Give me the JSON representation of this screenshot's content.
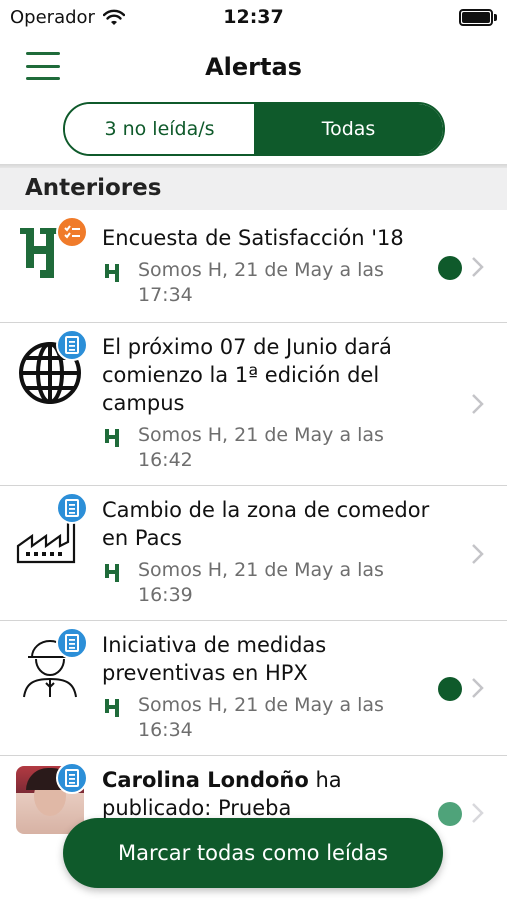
{
  "status_bar": {
    "carrier": "Operador",
    "time": "12:37"
  },
  "header": {
    "title": "Alertas"
  },
  "segmented": {
    "unread_label": "3 no leída/s",
    "all_label": "Todas",
    "selected": "Todas"
  },
  "section": {
    "title": "Anteriores"
  },
  "alerts": [
    {
      "icon": "h-logo-icon",
      "badge": "checklist-icon",
      "badge_color": "#f07b2a",
      "title": "Encuesta de Satisfacción '18",
      "author_bold": "",
      "meta": "Somos H, 21 de May a las 17:34",
      "unread": true
    },
    {
      "icon": "globe-icon",
      "badge": "document-icon",
      "badge_color": "#2c8fd8",
      "title": "El próximo 07 de Junio dará comienzo la 1ª edición del campus",
      "author_bold": "",
      "meta": "Somos H, 21 de May a las 16:42",
      "unread": false
    },
    {
      "icon": "factory-icon",
      "badge": "document-icon",
      "badge_color": "#2c8fd8",
      "title": "Cambio de la zona de comedor en Pacs",
      "author_bold": "",
      "meta": "Somos H, 21 de May a las 16:39",
      "unread": false
    },
    {
      "icon": "worker-icon",
      "badge": "document-icon",
      "badge_color": "#2c8fd8",
      "title": "Iniciativa de medidas preventivas en HPX",
      "author_bold": "",
      "meta": "Somos H, 21 de May a las 16:34",
      "unread": true
    },
    {
      "icon": "user-photo",
      "badge": "document-icon",
      "badge_color": "#2c8fd8",
      "title": "ha publicado: Prueba",
      "author_bold": "Carolina Londoño",
      "meta": "",
      "unread": true
    }
  ],
  "footer": {
    "mark_all_label": "Marcar todas como leídas"
  },
  "colors": {
    "brand_green": "#0f5a2b",
    "badge_orange": "#f07b2a",
    "badge_blue": "#2c8fd8"
  }
}
